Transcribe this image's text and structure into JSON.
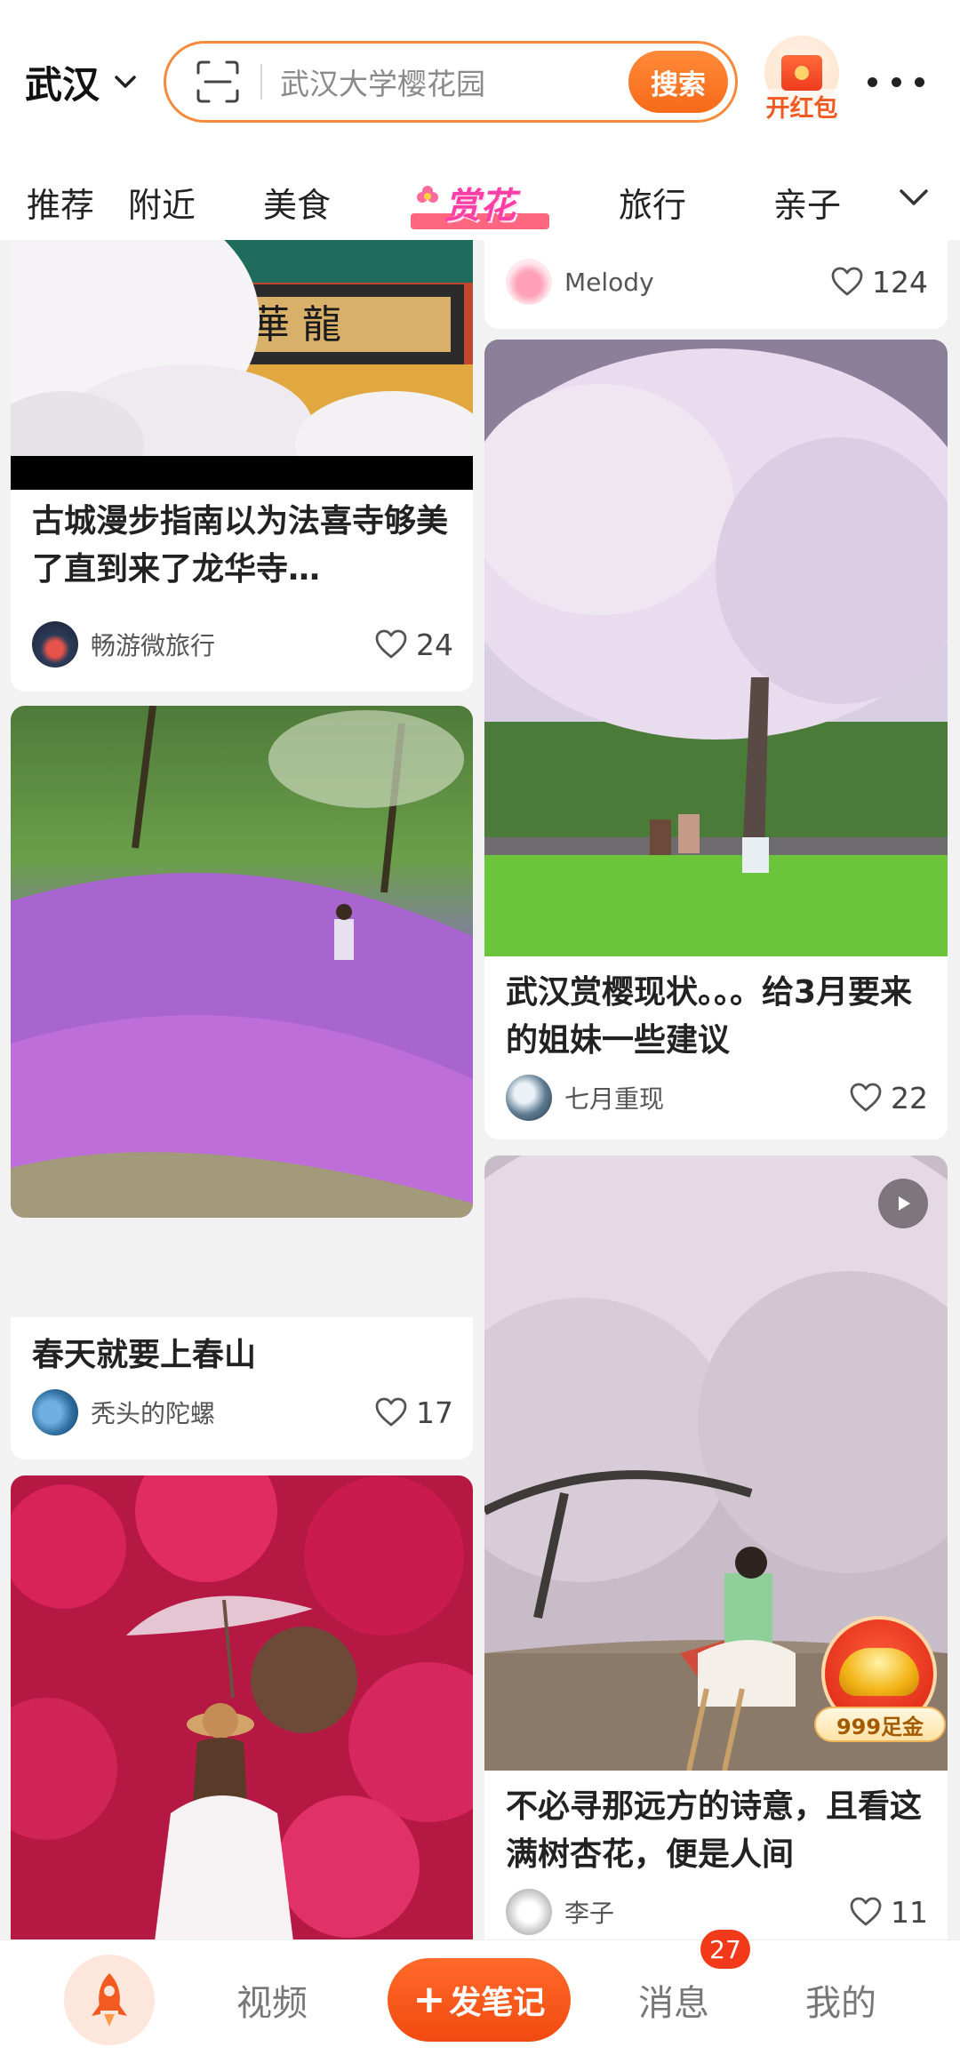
{
  "header": {
    "city": "武汉",
    "search_placeholder": "武汉大学樱花园",
    "search_button": "搜索",
    "red_packet_label": "开红包"
  },
  "tabs": [
    {
      "label": "推荐"
    },
    {
      "label": "附近"
    },
    {
      "label": "美食"
    },
    {
      "label": "赏花",
      "active": true
    },
    {
      "label": "旅行"
    },
    {
      "label": "亲子"
    }
  ],
  "feed": {
    "left": [
      {
        "title": "古城漫步指南以为法喜寺够美了直到来了龙华寺…",
        "author": "畅游微旅行",
        "likes": "24",
        "image": "temple-blossom"
      },
      {
        "title": "春天就要上春山",
        "author": "秃头的陀螺",
        "likes": "17",
        "image": "purple-flower-hill"
      },
      {
        "title": "",
        "image": "bougainvillea-umbrella"
      }
    ],
    "right": [
      {
        "author": "Melody",
        "likes": "124"
      },
      {
        "title": "武汉赏樱现状。。。给3月要来的姐妹一些建议",
        "author": "七月重现",
        "likes": "22",
        "image": "cherry-tree-lawn"
      },
      {
        "title": "不必寻那远方的诗意，且看这满树杏花，便是人间",
        "author": "李子",
        "likes": "11",
        "image": "apricot-blossom-wall",
        "is_video": true
      }
    ]
  },
  "gold_badge": {
    "label": "999足金"
  },
  "bottom_nav": {
    "video": "视频",
    "publish": "发笔记",
    "messages": "消息",
    "messages_badge": "27",
    "me": "我的"
  },
  "colors": {
    "accent": "#f76a18",
    "tab_active": "#ff3fa5",
    "background": "#f2f2f2"
  },
  "icons": [
    "chevron-down-icon",
    "scan-icon",
    "red-packet-icon",
    "more-icon",
    "heart-icon",
    "play-icon",
    "rocket-icon"
  ]
}
